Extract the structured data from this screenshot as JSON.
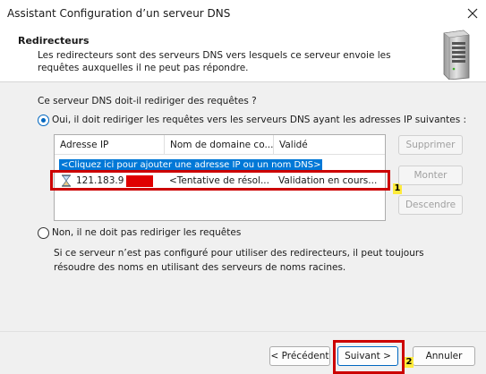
{
  "window": {
    "title": "Assistant Configuration d’un serveur DNS"
  },
  "header": {
    "title": "Redirecteurs",
    "description": "Les redirecteurs sont des serveurs DNS vers lesquels ce serveur envoie les requêtes auxquelles il ne peut pas répondre."
  },
  "question": "Ce serveur DNS doit-il rediriger des requêtes ?",
  "option_yes": {
    "label": "Oui, il doit rediriger les requêtes vers les serveurs DNS ayant les adresses IP suivantes :",
    "selected": true
  },
  "list": {
    "columns": [
      "Adresse IP",
      "Nom de domaine co...",
      "Validé"
    ],
    "placeholder": "<Cliquez ici pour ajouter une adresse IP ou un nom DNS>",
    "rows": [
      {
        "ip": "121.183.9",
        "domain": "<Tentative de résol...",
        "status": "Validation en cours..."
      }
    ]
  },
  "side_buttons": {
    "delete": "Supprimer",
    "up": "Monter",
    "down": "Descendre"
  },
  "option_no": {
    "label": "Non, il ne doit pas rediriger les requêtes",
    "description": "Si ce serveur n’est pas configuré pour utiliser des redirecteurs, il peut toujours résoudre des noms en utilisant des serveurs de noms racines.",
    "selected": false
  },
  "footer": {
    "back": "< Précédent",
    "next": "Suivant >",
    "cancel": "Annuler"
  },
  "markers": {
    "one": "1",
    "two": "2"
  },
  "colors": {
    "accent": "#0067c0",
    "highlight": "#cc0000",
    "selection": "#0078d7"
  }
}
